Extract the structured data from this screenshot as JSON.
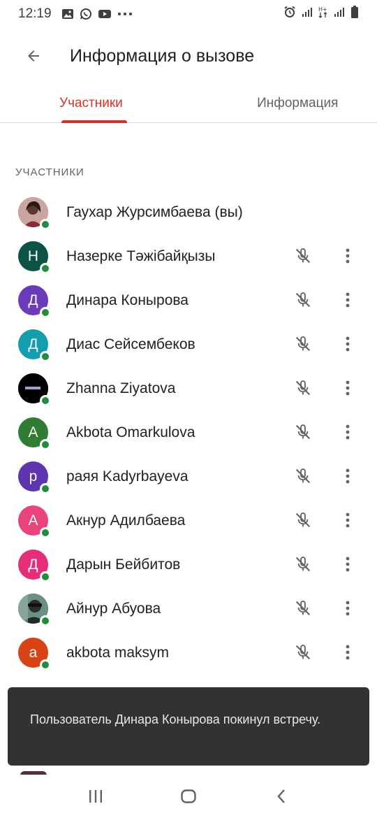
{
  "status_bar": {
    "time": "12:19",
    "icons_left": [
      "gallery-icon",
      "whatsapp-icon",
      "youtube-icon",
      "more-dots-icon"
    ],
    "icons_right": [
      "alarm-icon",
      "signal-icon",
      "data-h-plus-icon",
      "signal-icon",
      "battery-icon"
    ]
  },
  "app_bar": {
    "title": "Информация о вызове"
  },
  "tabs": [
    {
      "label": "Участники",
      "active": true
    },
    {
      "label": "Информация",
      "active": false
    }
  ],
  "section_label": "УЧАСТНИКИ",
  "participants": [
    {
      "name": "Гаухар Журсимбаева (вы)",
      "initial": "",
      "avatar_color": "#8a3a4a",
      "photo": true,
      "online": true,
      "show_controls": false
    },
    {
      "name": "Назерке Тәжібайқызы",
      "initial": "Н",
      "avatar_color": "#0b5345",
      "photo": false,
      "online": true,
      "show_controls": true
    },
    {
      "name": "Динара Конырова",
      "initial": "Д",
      "avatar_color": "#6a3ab8",
      "photo": false,
      "online": true,
      "show_controls": true
    },
    {
      "name": "Диас Сейсембеков",
      "initial": "Д",
      "avatar_color": "#129eaf",
      "photo": false,
      "online": true,
      "show_controls": true
    },
    {
      "name": "Zhanna Ziyatova",
      "initial": "",
      "avatar_color": "#000000",
      "photo": true,
      "online": true,
      "show_controls": true
    },
    {
      "name": "Akbota Omarkulova",
      "initial": "A",
      "avatar_color": "#2e7d32",
      "photo": false,
      "online": true,
      "show_controls": true
    },
    {
      "name": "раяя Kadyrbayeva",
      "initial": "р",
      "avatar_color": "#5e35b1",
      "photo": false,
      "online": true,
      "show_controls": true
    },
    {
      "name": "Акнур Адилбаева",
      "initial": "А",
      "avatar_color": "#e8437a",
      "photo": false,
      "online": true,
      "show_controls": true
    },
    {
      "name": "Дарын Бейбитов",
      "initial": "Д",
      "avatar_color": "#e52d7a",
      "photo": false,
      "online": true,
      "show_controls": true
    },
    {
      "name": "Айнур Абуова",
      "initial": "",
      "avatar_color": "#3b5b4a",
      "photo": true,
      "online": true,
      "show_controls": true
    },
    {
      "name": "akbota maksym",
      "initial": "a",
      "avatar_color": "#d84315",
      "photo": false,
      "online": true,
      "show_controls": true
    }
  ],
  "snackbar": {
    "message": "Пользователь Динара Конырова покинул встречу."
  },
  "colors": {
    "accent": "#d93025",
    "presence": "#1e8e3e",
    "snackbar_bg": "#323232"
  },
  "nav_bar": {
    "icons": [
      "recent-apps-icon",
      "home-icon",
      "back-icon"
    ]
  }
}
